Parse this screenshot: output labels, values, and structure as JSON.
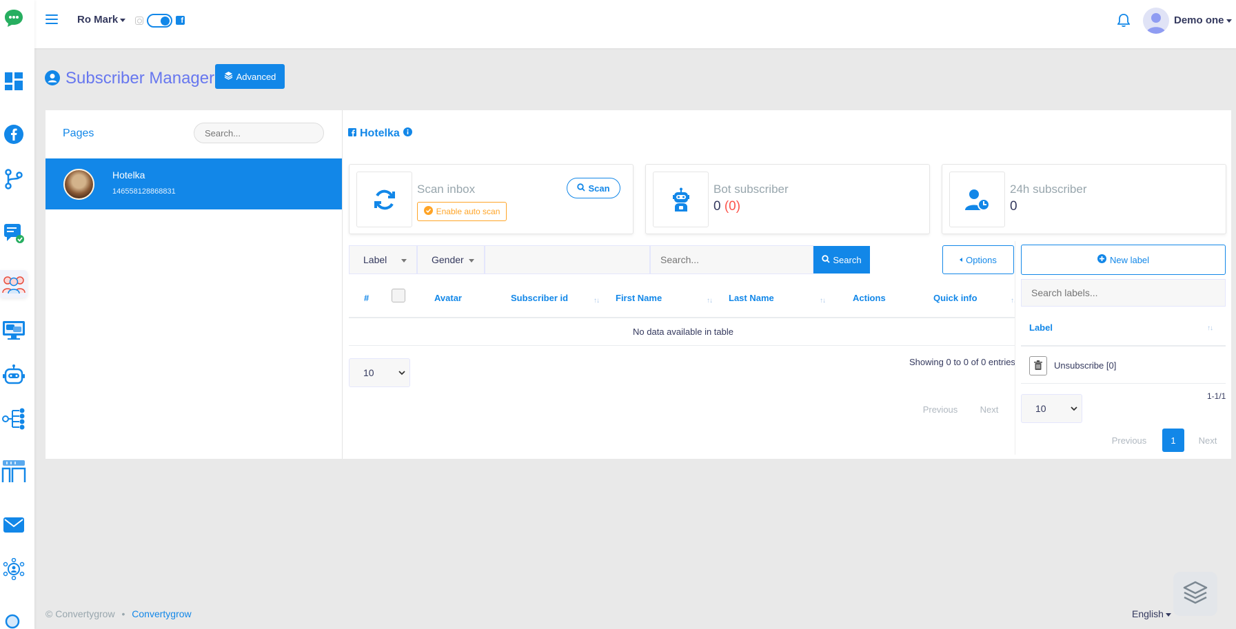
{
  "navbar": {
    "account": "Ro Mark",
    "user": "Demo one"
  },
  "page": {
    "title": "Subscriber Manager",
    "advanced_label": "Advanced"
  },
  "pages_panel": {
    "heading": "Pages",
    "search_placeholder": "Search...",
    "items": [
      {
        "name": "Hotelka",
        "id": "146558128868831"
      }
    ]
  },
  "main": {
    "page_name": "Hotelka",
    "cards": {
      "scan": {
        "label": "Scan inbox",
        "scan_button": "Scan",
        "auto_scan": "Enable auto scan"
      },
      "bot": {
        "label": "Bot subscriber",
        "value": "0",
        "value_red": "(0)"
      },
      "h24": {
        "label": "24h subscriber",
        "value": "0"
      }
    },
    "filters": {
      "label": "Label",
      "gender": "Gender",
      "search_placeholder": "Search...",
      "search_button": "Search",
      "options_button": "Options"
    },
    "table": {
      "columns": [
        "#",
        "Avatar",
        "Subscriber id",
        "First Name",
        "Last Name",
        "Actions",
        "Quick info"
      ],
      "empty": "No data available in table",
      "length": "10",
      "info": "Showing 0 to 0 of 0 entries",
      "previous": "Previous",
      "next": "Next"
    }
  },
  "labels_panel": {
    "new_label": "New label",
    "search_placeholder": "Search labels...",
    "column": "Label",
    "rows": [
      "Unsubscribe [0]"
    ],
    "length": "10",
    "info": "1-1/1",
    "previous": "Previous",
    "current_page": "1",
    "next": "Next"
  },
  "footer": {
    "copyright": "© Convertygrow",
    "separator": "•",
    "link": "Convertygrow",
    "language": "English"
  },
  "colors": {
    "primary": "#1287e8",
    "title": "#6777ef",
    "warning": "#ffa426",
    "danger": "#fc544b"
  }
}
